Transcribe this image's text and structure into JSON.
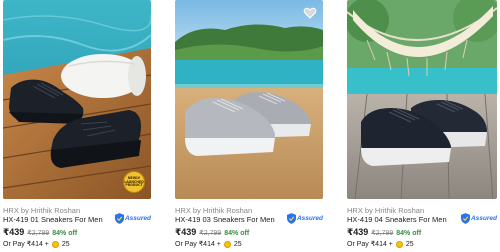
{
  "colors": {
    "discount": "#388e3c",
    "assured": "#2874f0",
    "coin": "#f7c600"
  },
  "products": [
    {
      "brand": "HRX by Hrithik Roshan",
      "title": "HX-419 01 Sneakers For Men",
      "assured_label": "Assured",
      "price": "₹439",
      "mrp": "₹2,799",
      "discount": "84% off",
      "pay_text": "Or Pay ₹414 +",
      "coins": "25",
      "badge_text": "NEWLY LAUNCHED PRODUCT"
    },
    {
      "brand": "HRX by Hrithik Roshan",
      "title": "HX-419 03 Sneakers For Men",
      "assured_label": "Assured",
      "price": "₹439",
      "mrp": "₹2,799",
      "discount": "84% off",
      "pay_text": "Or Pay ₹414 +",
      "coins": "25"
    },
    {
      "brand": "HRX by Hrithik Roshan",
      "title": "HX-419 04 Sneakers For Men",
      "assured_label": "Assured",
      "price": "₹439",
      "mrp": "₹2,799",
      "discount": "84% off",
      "pay_text": "Or Pay ₹414 +",
      "coins": "25"
    }
  ]
}
